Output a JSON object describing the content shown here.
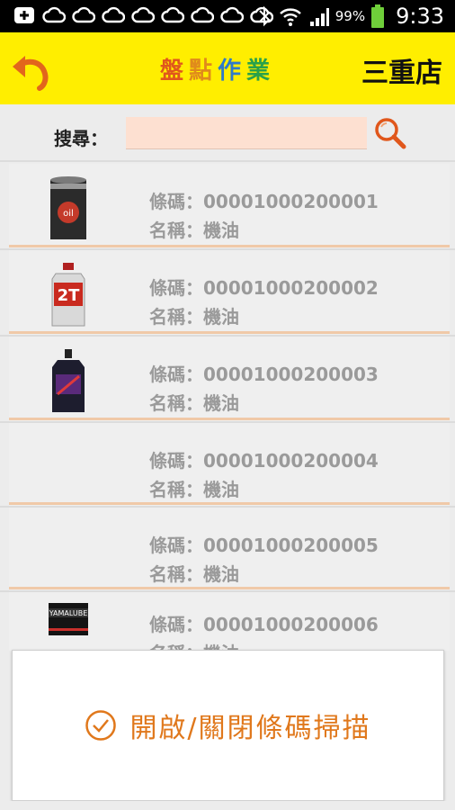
{
  "status_bar": {
    "battery": "99%",
    "clock": "9:33"
  },
  "header": {
    "title_chars": [
      "盤",
      "點",
      "作",
      "業"
    ],
    "store": "三重店",
    "icons": {
      "back": "back-arrow-icon"
    }
  },
  "search": {
    "label": "搜尋：",
    "value": "",
    "placeholder": "",
    "icon": "search-icon"
  },
  "items": [
    {
      "barcode": "條碼：00001000200001",
      "name": "名稱：機油",
      "thumb": "oil-can"
    },
    {
      "barcode": "條碼：00001000200002",
      "name": "名稱：機油",
      "thumb": "oil-bottle-2t"
    },
    {
      "barcode": "條碼：00001000200003",
      "name": "名稱：機油",
      "thumb": "oil-bottle-dark"
    },
    {
      "barcode": "條碼：00001000200004",
      "name": "名稱：機油",
      "thumb": ""
    },
    {
      "barcode": "條碼：00001000200005",
      "name": "名稱：機油",
      "thumb": ""
    },
    {
      "barcode": "條碼：00001000200006",
      "name": "名稱：機油",
      "thumb": "yamalube-can"
    }
  ],
  "scan_toggle": {
    "label": "開啟/關閉條碼掃描",
    "icon": "check-circle-icon"
  },
  "colors": {
    "header_bg": "#ffee00",
    "accent": "#e0781c",
    "search_bg": "#fde0d1"
  }
}
